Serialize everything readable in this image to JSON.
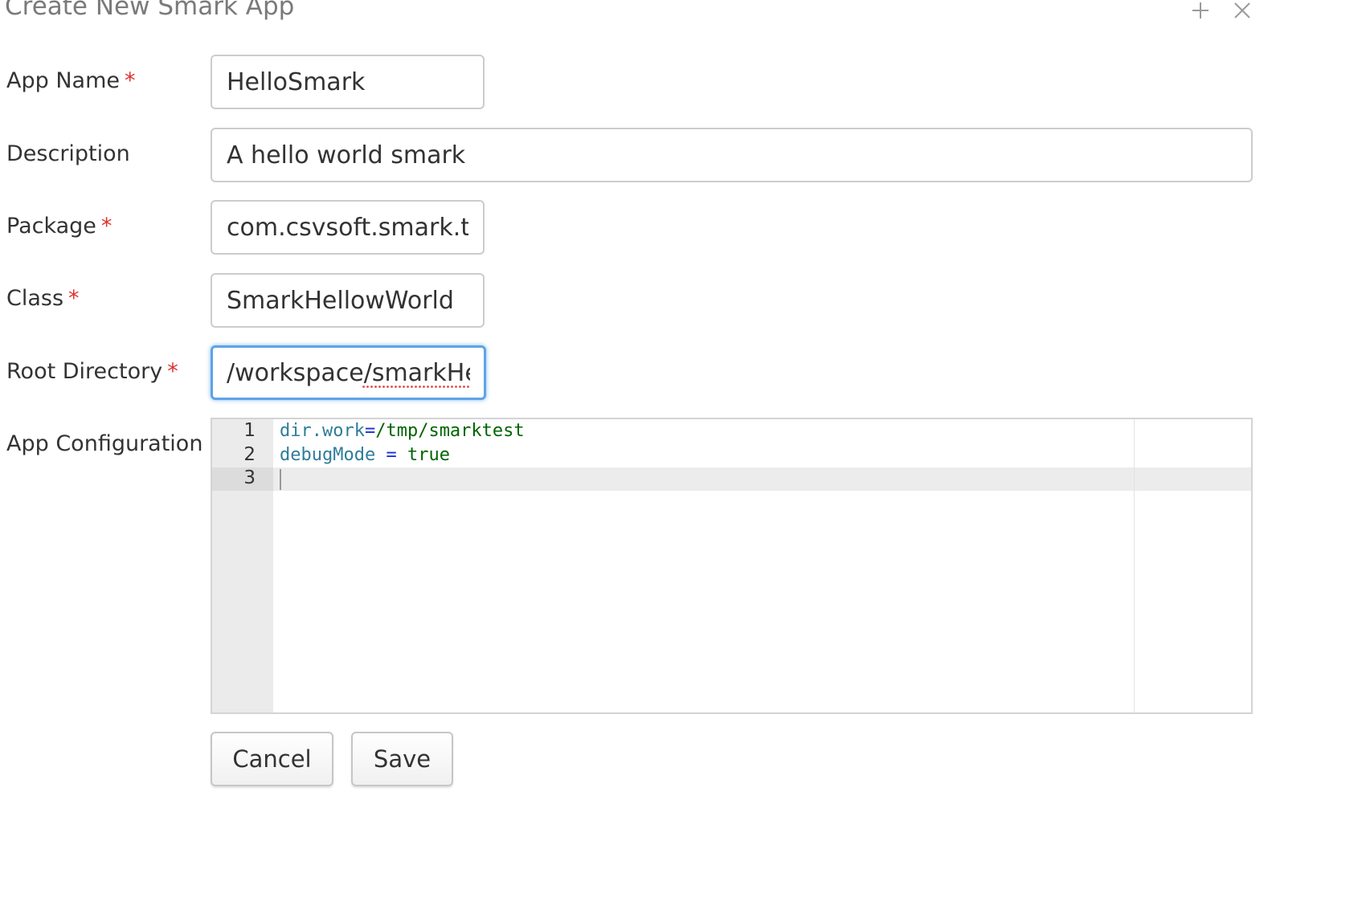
{
  "dialog": {
    "title": "Create New Smark App"
  },
  "header_icons": {
    "expand": "plus-icon",
    "close": "close-icon"
  },
  "required_marker": "*",
  "form": {
    "app_name": {
      "label": "App Name",
      "value": "HelloSmark"
    },
    "description": {
      "label": "Description",
      "value": "A hello world smark"
    },
    "package": {
      "label": "Package",
      "value": "com.csvsoft.smark.tes"
    },
    "class": {
      "label": "Class",
      "value": "SmarkHellowWorld"
    },
    "root_directory": {
      "label": "Root Directory",
      "value": "/workspace/smarkHell"
    },
    "app_configuration": {
      "label": "App Configuration",
      "line_numbers": [
        "1",
        "2",
        "3"
      ],
      "lines": [
        {
          "key": "dir.work",
          "op": "=",
          "value": "/tmp/smarktest"
        },
        {
          "key": "debugMode",
          "op": " = ",
          "value": "true"
        },
        {
          "key": "",
          "op": "",
          "value": ""
        }
      ]
    }
  },
  "buttons": {
    "cancel": "Cancel",
    "save": "Save"
  },
  "colors": {
    "required_star": "#e0302b",
    "focus_border": "#5ea3e8",
    "config_key": "#2e7d9a",
    "config_operator": "#1a2fd8",
    "config_value": "#006400"
  }
}
